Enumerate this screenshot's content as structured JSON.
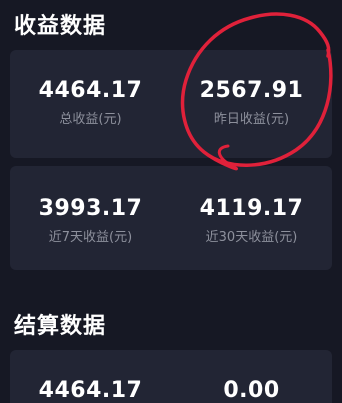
{
  "income": {
    "title": "收益数据",
    "items": [
      {
        "value": "4464.17",
        "label": "总收益(元)"
      },
      {
        "value": "2567.91",
        "label": "昨日收益(元)"
      },
      {
        "value": "3993.17",
        "label": "近7天收益(元)"
      },
      {
        "value": "4119.17",
        "label": "近30天收益(元)"
      }
    ]
  },
  "settlement": {
    "title": "结算数据",
    "items": [
      {
        "value": "4464.17"
      },
      {
        "value": "0.00"
      }
    ]
  },
  "colors": {
    "background": "#161824",
    "card": "#222534",
    "label": "#8d909c",
    "annotation": "#e0213a"
  }
}
